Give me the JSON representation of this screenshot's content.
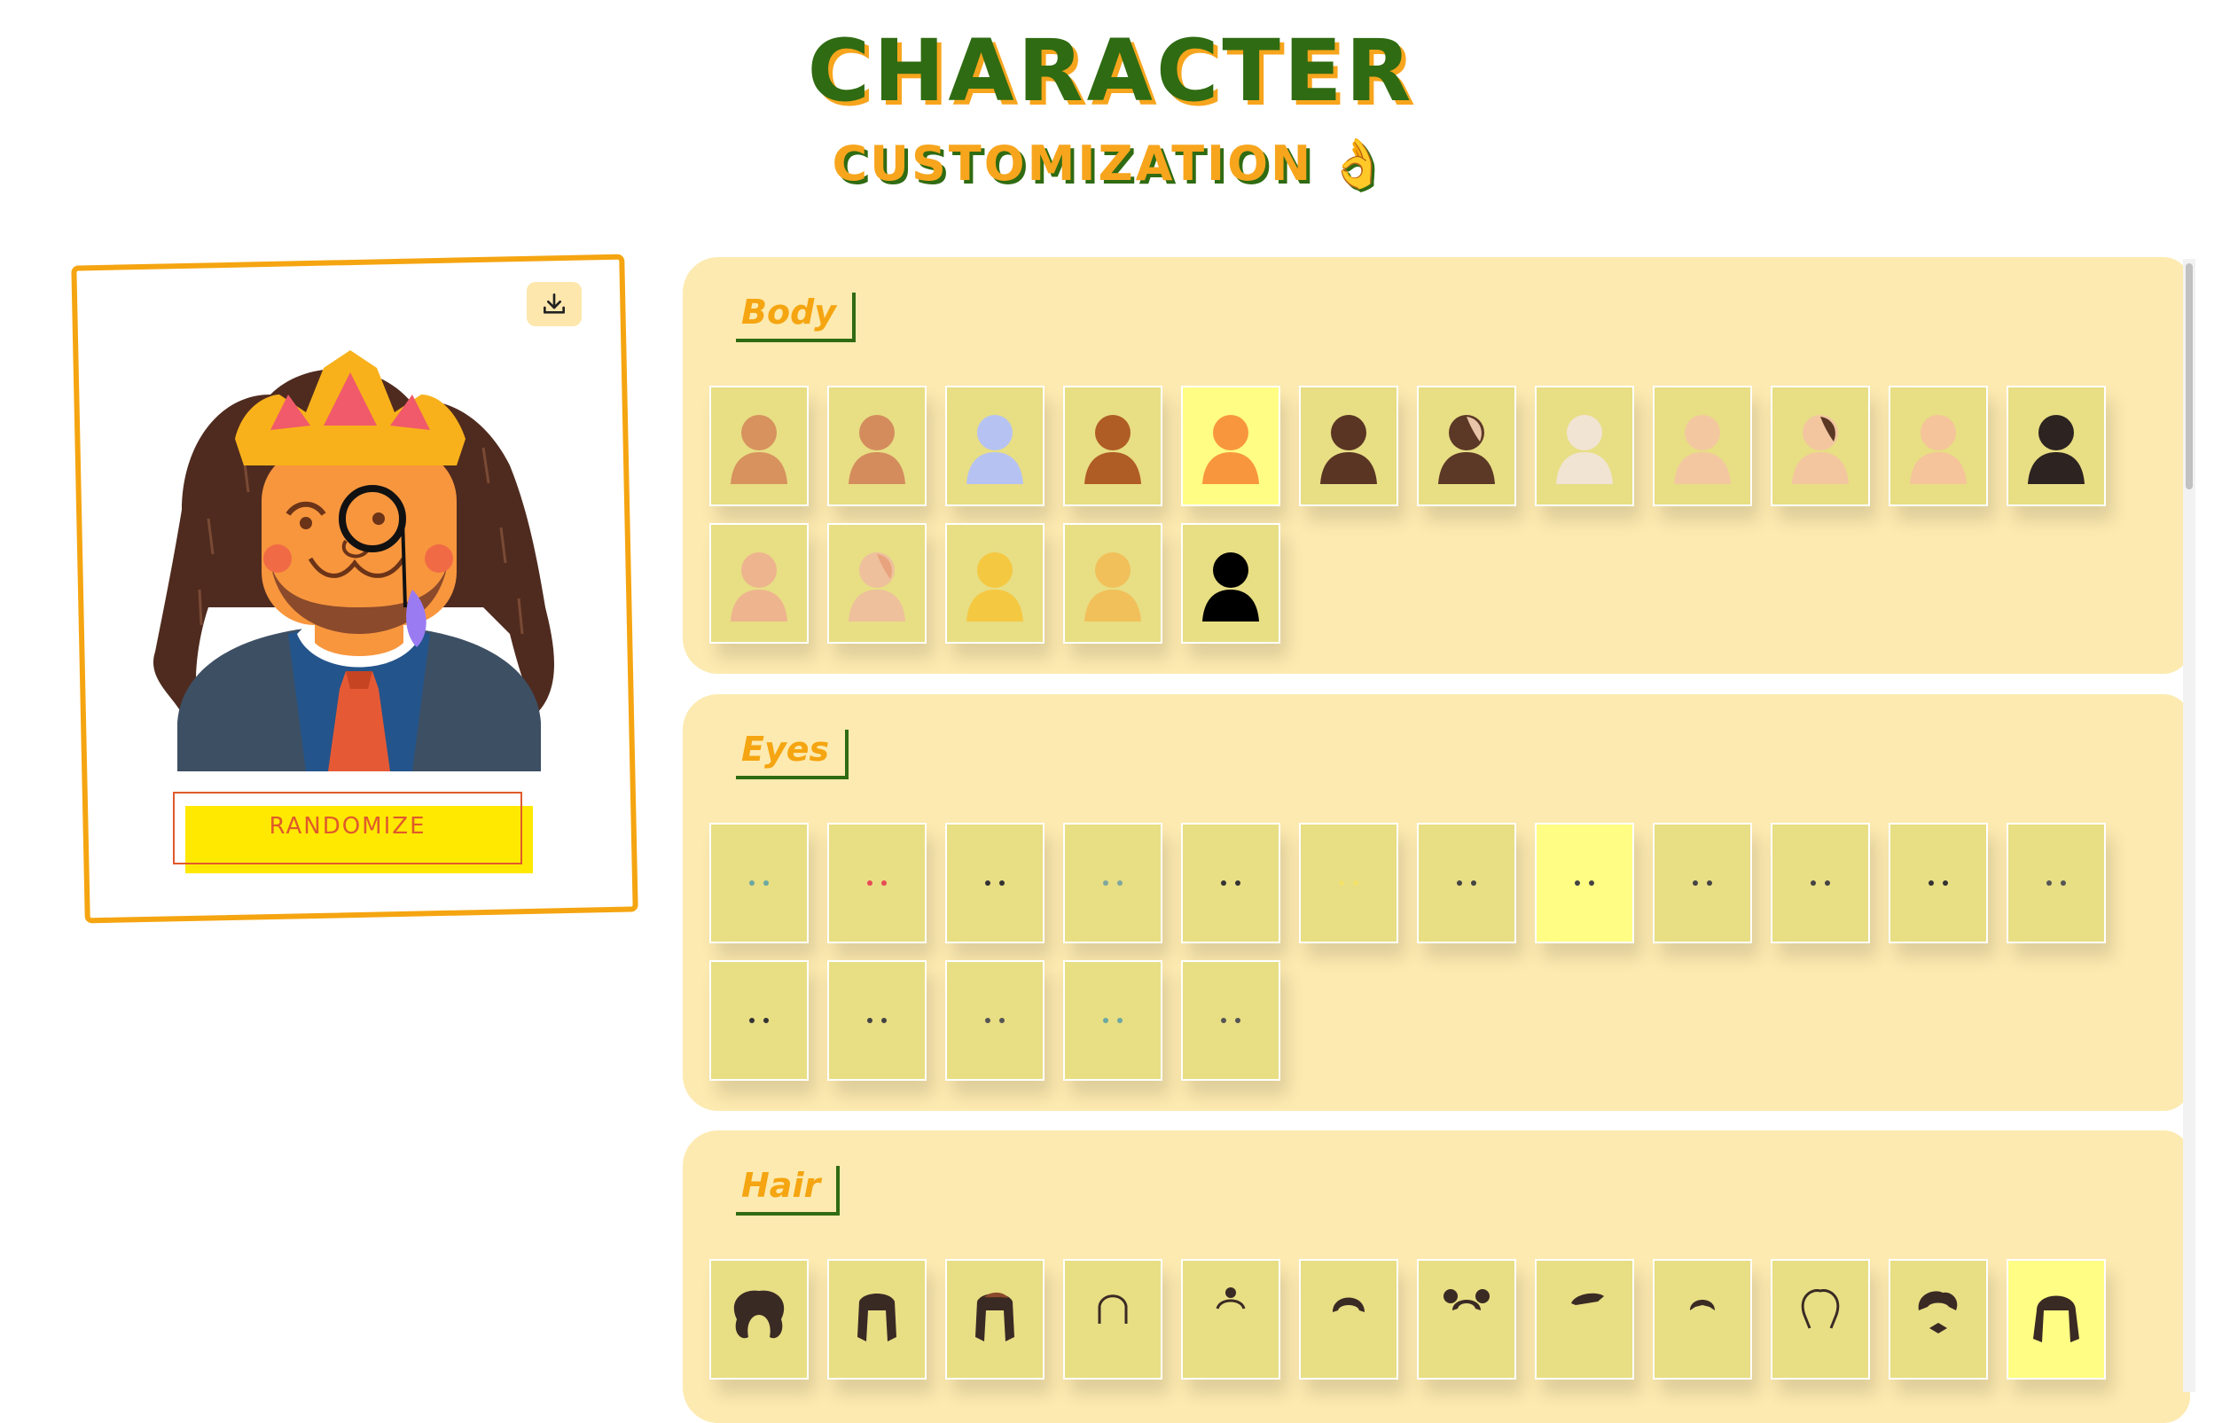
{
  "header": {
    "title": "CHARACTER",
    "subtitle": "CUSTOMIZATION",
    "subtitle_icon": "ok-hand-emoji"
  },
  "preview": {
    "download_icon": "download-icon",
    "randomize_label": "RANDOMIZE"
  },
  "sections": [
    {
      "title": "Body",
      "type": "body",
      "selected_index": 4,
      "options": [
        {
          "skin": "#d7925e",
          "hair": ""
        },
        {
          "skin": "#d48c5d",
          "hair": ""
        },
        {
          "skin": "#b6c3f2",
          "hair": ""
        },
        {
          "skin": "#b05c25",
          "hair": ""
        },
        {
          "skin": "#f8963e",
          "hair": ""
        },
        {
          "skin": "#5a3523",
          "hair": ""
        },
        {
          "skin": "#5c3826",
          "hair": "#e8c4a8"
        },
        {
          "skin": "#f1e4d3",
          "hair": ""
        },
        {
          "skin": "#f3c8a0",
          "hair": ""
        },
        {
          "skin": "#f3c6a0",
          "hair": "#5b3824"
        },
        {
          "skin": "#f5c49a",
          "hair": ""
        },
        {
          "skin": "#2d2320",
          "hair": ""
        },
        {
          "skin": "#eeb48e",
          "hair": ""
        },
        {
          "skin": "#eec09b",
          "hair": "#e9a27e"
        },
        {
          "skin": "#f5c842",
          "hair": ""
        },
        {
          "skin": "#f1c05a",
          "hair": ""
        },
        {
          "skin": "#000000",
          "hair": ""
        }
      ]
    },
    {
      "title": "Eyes",
      "type": "eyes",
      "selected_index": 7,
      "options": [
        {
          "color": "#6aa8a3"
        },
        {
          "color": "#e84b55"
        },
        {
          "color": "#333333"
        },
        {
          "color": "#7fa7a0"
        },
        {
          "color": "#333333"
        },
        {
          "color": "#f2e26b"
        },
        {
          "color": "#444444"
        },
        {
          "color": "#444444"
        },
        {
          "color": "#444444"
        },
        {
          "color": "#444444"
        },
        {
          "color": "#333333"
        },
        {
          "color": "#555555"
        },
        {
          "color": "#333333"
        },
        {
          "color": "#444444"
        },
        {
          "color": "#555555"
        },
        {
          "color": "#6aa8a3"
        },
        {
          "color": "#555555"
        }
      ]
    },
    {
      "title": "Hair",
      "type": "hair",
      "selected_index": 11,
      "options": [
        {
          "style": "curly"
        },
        {
          "style": "long"
        },
        {
          "style": "long-red"
        },
        {
          "style": "outline"
        },
        {
          "style": "bun"
        },
        {
          "style": "short"
        },
        {
          "style": "puffs"
        },
        {
          "style": "quiff"
        },
        {
          "style": "crop"
        },
        {
          "style": "afro-outline"
        },
        {
          "style": "wavy"
        },
        {
          "style": "locs"
        }
      ]
    }
  ],
  "colors": {
    "accent_orange": "#f5a511",
    "title_green": "#2f6b12",
    "panel_bg": "#fdeab0",
    "tile_bg": "#e8de84",
    "tile_selected": "#fffd83",
    "randomize_text": "#e05a2b",
    "randomize_bg": "#ffe900"
  }
}
